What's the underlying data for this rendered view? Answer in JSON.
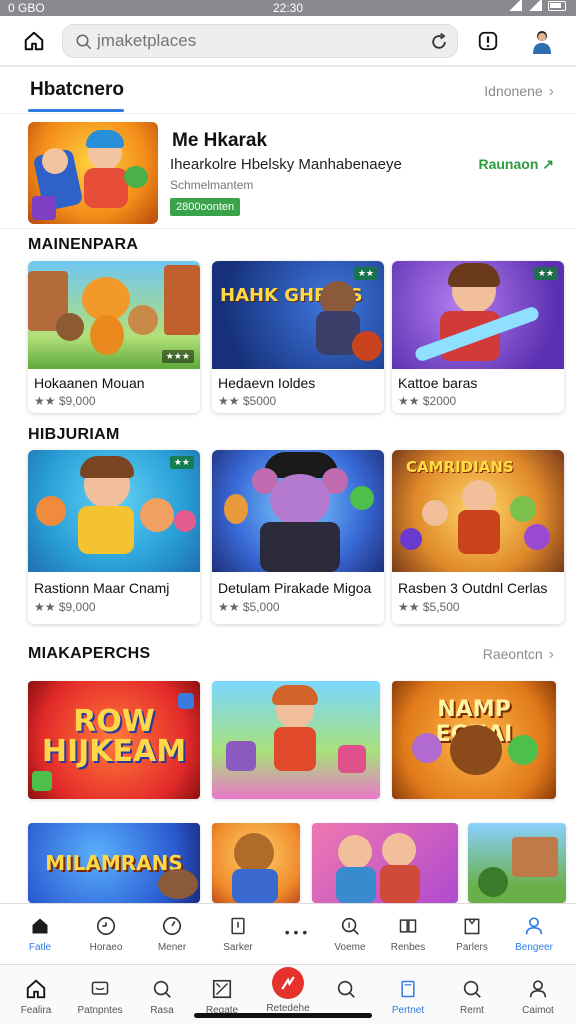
{
  "status_bar": {
    "left": "0 GBO",
    "center": "22:30"
  },
  "top_bar": {
    "search_placeholder": "jmaketplaces"
  },
  "featured": {
    "title": "Hbatcnero",
    "see_all": "Idnonene",
    "item": {
      "title": "Me Hkarak",
      "subtitle": "Ihearkolre Hbelsky Manhabenaeye",
      "meta": "Schmelmantem",
      "badge": "2800oonten",
      "action": "Raunaon"
    }
  },
  "sections": [
    {
      "title": "MAINENPARA",
      "cards": [
        {
          "name": "Hokaanen Mouan",
          "price": "★★ $9,000",
          "art_title": ""
        },
        {
          "name": "Hedaevn Ioldes",
          "price": "★★ $5000",
          "art_title": "HAHK GHRNIS"
        },
        {
          "name": "Kattoe baras",
          "price": "★★ $2000",
          "art_title": ""
        }
      ]
    },
    {
      "title": "HIBJURIAM",
      "cards": [
        {
          "name": "Rastionn Maar Cnamj",
          "price": "★★ $9,000",
          "art_title": ""
        },
        {
          "name": "Detulam Pirakade Migoa",
          "price": "★★ $5,000",
          "art_title": ""
        },
        {
          "name": "Rasben 3 Outdnl Cerlas",
          "price": "★★ $5,500",
          "art_title": "CAMRIDIANS"
        }
      ]
    },
    {
      "title": "MIAKAPERCHS",
      "see_all": "Raeontcn",
      "promos": [
        {
          "art_title": "ROW HIJKEAM"
        },
        {
          "art_title": ""
        },
        {
          "art_title": "NAMP EGNAI"
        },
        {
          "art_title": "MILAMRANS"
        },
        {
          "art_title": ""
        },
        {
          "art_title": ""
        },
        {
          "art_title": ""
        }
      ]
    }
  ],
  "tabbar_primary": [
    {
      "label": "Fatle",
      "icon": "home-icon"
    },
    {
      "label": "Horaeo",
      "icon": "clock-face-icon"
    },
    {
      "label": "Mener",
      "icon": "gauge-icon"
    },
    {
      "label": "Sarker",
      "icon": "tablet-icon"
    },
    {
      "label": "Voeme",
      "icon": "search-plus-icon"
    },
    {
      "label": "Renbes",
      "icon": "book-icon"
    },
    {
      "label": "Parlers",
      "icon": "cabinet-icon"
    },
    {
      "label": "Bengeer",
      "icon": "person-icon"
    }
  ],
  "tabbar_secondary": [
    {
      "label": "Fealira",
      "icon": "home-icon"
    },
    {
      "label": "Patnpntes",
      "icon": "message-icon"
    },
    {
      "label": "Rasa",
      "icon": "search-icon"
    },
    {
      "label": "Regate",
      "icon": "grid-icon"
    },
    {
      "label": "Retedehe",
      "icon": "sparkle-icon"
    },
    {
      "label": "",
      "icon": "search-icon"
    },
    {
      "label": "Pertnet",
      "icon": "tablet-icon"
    },
    {
      "label": "Remt",
      "icon": "search-icon"
    },
    {
      "label": "Caimot",
      "icon": "person-icon"
    }
  ]
}
